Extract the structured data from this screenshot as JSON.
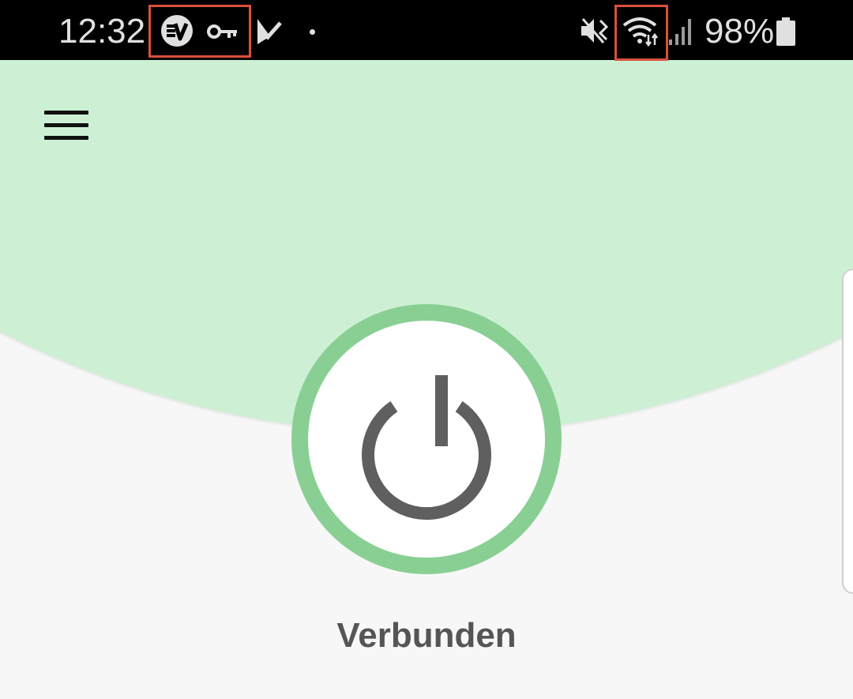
{
  "status_bar": {
    "time": "12:32",
    "battery_percent": "98%",
    "icons": [
      "expressvpn-icon",
      "vpn-key-icon",
      "task-check-icon",
      "notification-dot-icon",
      "vibrate-mute-icon",
      "wifi-data-icon",
      "signal-icon",
      "battery-icon"
    ],
    "highlight_color": "#d9503c"
  },
  "app": {
    "menu_icon": "hamburger-menu-icon",
    "power_icon": "power-icon",
    "connection_status": "Verbunden",
    "colors": {
      "header_green": "#cdf0d4",
      "ring_green": "#89cf94",
      "icon_gray": "#5f5f5f",
      "label_gray": "#555555",
      "background": "#f7f7f7"
    }
  }
}
